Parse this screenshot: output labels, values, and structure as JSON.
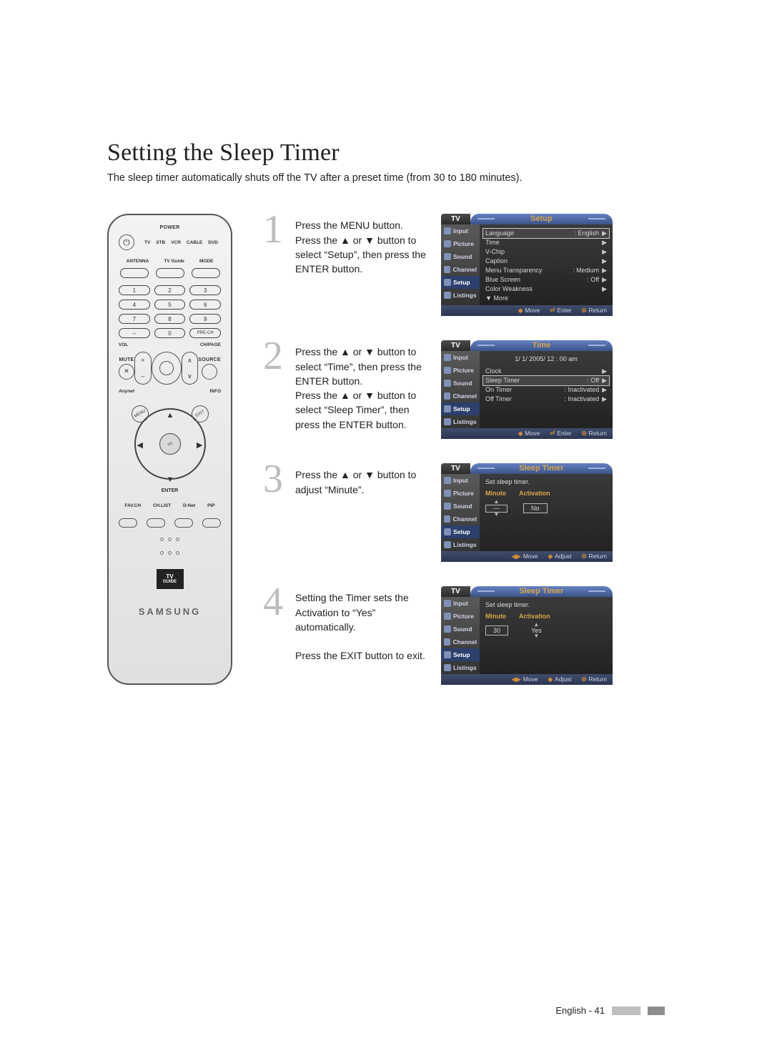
{
  "title": "Setting the Sleep Timer",
  "intro": "The sleep timer automatically shuts off the TV after a preset time (from 30 to 180 minutes).",
  "remote": {
    "power": "POWER",
    "devices": [
      "TV",
      "STB",
      "VCR",
      "CABLE",
      "DVD"
    ],
    "row_labels": [
      "ANTENNA",
      "TV Guide",
      "MODE"
    ],
    "numbers": [
      "1",
      "2",
      "3",
      "4",
      "5",
      "6",
      "7",
      "8",
      "9",
      "–",
      "0",
      "PRE-CH"
    ],
    "vol": "VOL",
    "ch": "CH/PAGE",
    "mute": "MUTE",
    "source": "SOURCE",
    "anynet": "Anynet",
    "info": "INFO",
    "menu": "MENU",
    "exit": "EXIT",
    "enter": "ENTER",
    "bottom_labels": [
      "FAV.CH",
      "CH.LIST",
      "D-Net",
      "PIP"
    ],
    "tvguide_top": "TV",
    "tvguide_bottom": "GUIDE",
    "brand": "SAMSUNG"
  },
  "steps": [
    {
      "n": "1",
      "text": "Press the MENU button.\nPress the ▲ or ▼ button to select “Setup”, then press the ENTER button."
    },
    {
      "n": "2",
      "text": "Press the ▲ or ▼ button to select “Time”, then press the ENTER button.\nPress the ▲ or ▼ button to select “Sleep Timer”, then press the ENTER button."
    },
    {
      "n": "3",
      "text": "Press the ▲ or ▼ button to adjust “Minute”."
    },
    {
      "n": "4",
      "text": "Setting the Timer sets the Activation to “Yes” automatically.\n\nPress the EXIT button to exit."
    }
  ],
  "osd_side": [
    "Input",
    "Picture",
    "Sound",
    "Channel",
    "Setup",
    "Listings"
  ],
  "osd_tv": "TV",
  "osd1": {
    "title": "Setup",
    "selected_side": "Setup",
    "rows": [
      {
        "k": "Language",
        "v": ": English",
        "sel": true
      },
      {
        "k": "Time",
        "v": ""
      },
      {
        "k": "V-Chip",
        "v": ""
      },
      {
        "k": "Caption",
        "v": ""
      },
      {
        "k": "Menu Transparency",
        "v": ": Medium"
      },
      {
        "k": "Blue Screen",
        "v": ": Off"
      },
      {
        "k": "Color Weakness",
        "v": ""
      },
      {
        "k": "▼ More",
        "v": "",
        "noarrow": true
      }
    ],
    "foot": [
      [
        "◆",
        "Move"
      ],
      [
        "⏎",
        "Enter"
      ],
      [
        "⦾",
        "Return"
      ]
    ]
  },
  "osd2": {
    "title": "Time",
    "selected_side": "Setup",
    "datetime": "1/ 1/ 2005/ 12 : 00 am",
    "rows": [
      {
        "k": "Clock",
        "v": ""
      },
      {
        "k": "Sleep Timer",
        "v": ": Off",
        "sel": true
      },
      {
        "k": "On Timer",
        "v": ": Inactivated"
      },
      {
        "k": "Off Timer",
        "v": ": Inactivated"
      }
    ],
    "foot": [
      [
        "◆",
        "Move"
      ],
      [
        "⏎",
        "Enter"
      ],
      [
        "⦾",
        "Return"
      ]
    ]
  },
  "osd3": {
    "title": "Sleep Timer",
    "selected_side": "Setup",
    "prompt": "Set sleep timer.",
    "fields": {
      "minute_label": "Minute",
      "activation_label": "Activation",
      "minute": "---",
      "activation": "No"
    },
    "foot": [
      [
        "◀▶",
        "Move"
      ],
      [
        "◆",
        "Adjust"
      ],
      [
        "⦾",
        "Return"
      ]
    ]
  },
  "osd4": {
    "title": "Sleep Timer",
    "selected_side": "Setup",
    "prompt": "Set sleep timer.",
    "fields": {
      "minute_label": "Minute",
      "activation_label": "Activation",
      "minute": "30",
      "activation": "Yes"
    },
    "foot": [
      [
        "◀▶",
        "Move"
      ],
      [
        "◆",
        "Adjust"
      ],
      [
        "⦾",
        "Return"
      ]
    ]
  },
  "footer": {
    "lang": "English",
    "page": "41"
  }
}
